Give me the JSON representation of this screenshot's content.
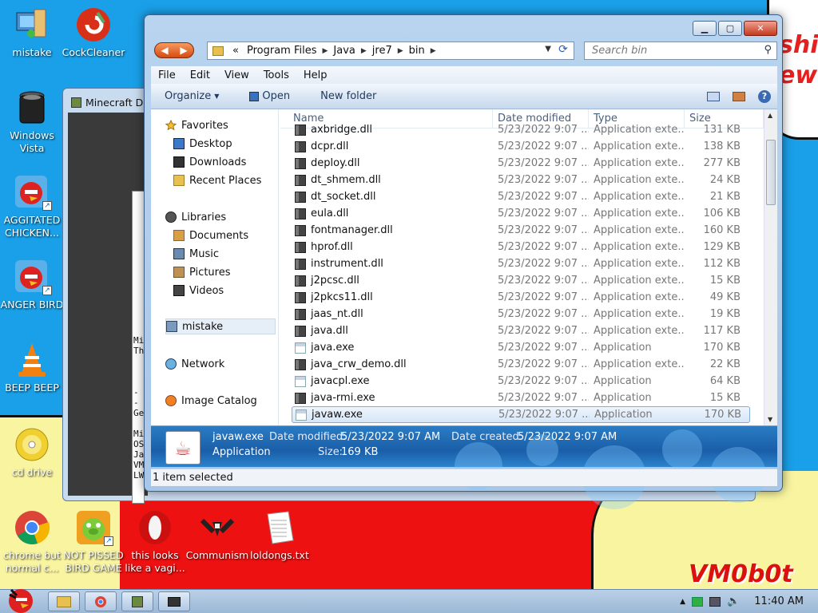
{
  "desktop": {
    "icons": [
      {
        "label": "mistake"
      },
      {
        "label": "CockCleaner"
      },
      {
        "label": "Windows Vista"
      },
      {
        "label": "AGGITATED CHICKEN..."
      },
      {
        "label": "ANGER BIRD"
      },
      {
        "label": "BEEP BEEP"
      },
      {
        "label": "cd drive"
      },
      {
        "label": "chrome but normal c..."
      },
      {
        "label": "NOT PISSED BIRD GAME"
      },
      {
        "label": "this looks like a vagi..."
      },
      {
        "label": "Communism"
      },
      {
        "label": "loldongs.txt"
      }
    ],
    "wallpaper_text": "shit\new",
    "watermark": "VM0b0t"
  },
  "background_window": {
    "title": "Minecraft De",
    "console_lines": [
      "Mi",
      "Th",
      "",
      "",
      "",
      "--",
      "Ge",
      "",
      "Mi",
      "OS",
      "Ja",
      "VM",
      "LW"
    ]
  },
  "explorer": {
    "address": {
      "overflow": "«",
      "segments": [
        "Program Files",
        "Java",
        "jre7",
        "bin"
      ]
    },
    "search": {
      "placeholder": "Search bin"
    },
    "menu": [
      "File",
      "Edit",
      "View",
      "Tools",
      "Help"
    ],
    "commands": {
      "organize": "Organize",
      "open": "Open",
      "new_folder": "New folder"
    },
    "nav": {
      "favorites": "Favorites",
      "desktop": "Desktop",
      "downloads": "Downloads",
      "recent": "Recent Places",
      "libraries": "Libraries",
      "documents": "Documents",
      "music": "Music",
      "pictures": "Pictures",
      "videos": "Videos",
      "user": "mistake",
      "network": "Network",
      "image_catalog": "Image Catalog"
    },
    "columns": {
      "name": "Name",
      "date": "Date modified",
      "type": "Type",
      "size": "Size"
    },
    "files": [
      {
        "name": "axbridge.dll",
        "date": "5/23/2022 9:07 ...",
        "type": "Application exte...",
        "size": "131 KB",
        "kind": "dll"
      },
      {
        "name": "dcpr.dll",
        "date": "5/23/2022 9:07 ...",
        "type": "Application exte...",
        "size": "138 KB",
        "kind": "dll"
      },
      {
        "name": "deploy.dll",
        "date": "5/23/2022 9:07 ...",
        "type": "Application exte...",
        "size": "277 KB",
        "kind": "dll"
      },
      {
        "name": "dt_shmem.dll",
        "date": "5/23/2022 9:07 ...",
        "type": "Application exte...",
        "size": "24 KB",
        "kind": "dll"
      },
      {
        "name": "dt_socket.dll",
        "date": "5/23/2022 9:07 ...",
        "type": "Application exte...",
        "size": "21 KB",
        "kind": "dll"
      },
      {
        "name": "eula.dll",
        "date": "5/23/2022 9:07 ...",
        "type": "Application exte...",
        "size": "106 KB",
        "kind": "dll"
      },
      {
        "name": "fontmanager.dll",
        "date": "5/23/2022 9:07 ...",
        "type": "Application exte...",
        "size": "160 KB",
        "kind": "dll"
      },
      {
        "name": "hprof.dll",
        "date": "5/23/2022 9:07 ...",
        "type": "Application exte...",
        "size": "129 KB",
        "kind": "dll"
      },
      {
        "name": "instrument.dll",
        "date": "5/23/2022 9:07 ...",
        "type": "Application exte...",
        "size": "112 KB",
        "kind": "dll"
      },
      {
        "name": "j2pcsc.dll",
        "date": "5/23/2022 9:07 ...",
        "type": "Application exte...",
        "size": "15 KB",
        "kind": "dll"
      },
      {
        "name": "j2pkcs11.dll",
        "date": "5/23/2022 9:07 ...",
        "type": "Application exte...",
        "size": "49 KB",
        "kind": "dll"
      },
      {
        "name": "jaas_nt.dll",
        "date": "5/23/2022 9:07 ...",
        "type": "Application exte...",
        "size": "19 KB",
        "kind": "dll"
      },
      {
        "name": "java.dll",
        "date": "5/23/2022 9:07 ...",
        "type": "Application exte...",
        "size": "117 KB",
        "kind": "dll"
      },
      {
        "name": "java.exe",
        "date": "5/23/2022 9:07 ...",
        "type": "Application",
        "size": "170 KB",
        "kind": "exe"
      },
      {
        "name": "java_crw_demo.dll",
        "date": "5/23/2022 9:07 ...",
        "type": "Application exte...",
        "size": "22 KB",
        "kind": "dll"
      },
      {
        "name": "javacpl.exe",
        "date": "5/23/2022 9:07 ...",
        "type": "Application",
        "size": "64 KB",
        "kind": "exe"
      },
      {
        "name": "java-rmi.exe",
        "date": "5/23/2022 9:07 ...",
        "type": "Application",
        "size": "15 KB",
        "kind": "dll"
      },
      {
        "name": "javaw.exe",
        "date": "5/23/2022 9:07 ...",
        "type": "Application",
        "size": "170 KB",
        "kind": "exe",
        "selected": true
      }
    ],
    "details": {
      "name": "javaw.exe",
      "type": "Application",
      "modified_label": "Date modified:",
      "modified": "5/23/2022 9:07 AM",
      "created_label": "Date created:",
      "created": "5/23/2022 9:07 AM",
      "size_label": "Size:",
      "size": "169 KB"
    },
    "status": "1 item selected"
  },
  "taskbar": {
    "clock": "11:40 AM"
  },
  "colors": {
    "desktop_bg": "#1aa0e8",
    "wall_red": "#ee1111",
    "wall_yellow": "#f8f4a0",
    "details_bg": "#1a5ea8"
  }
}
